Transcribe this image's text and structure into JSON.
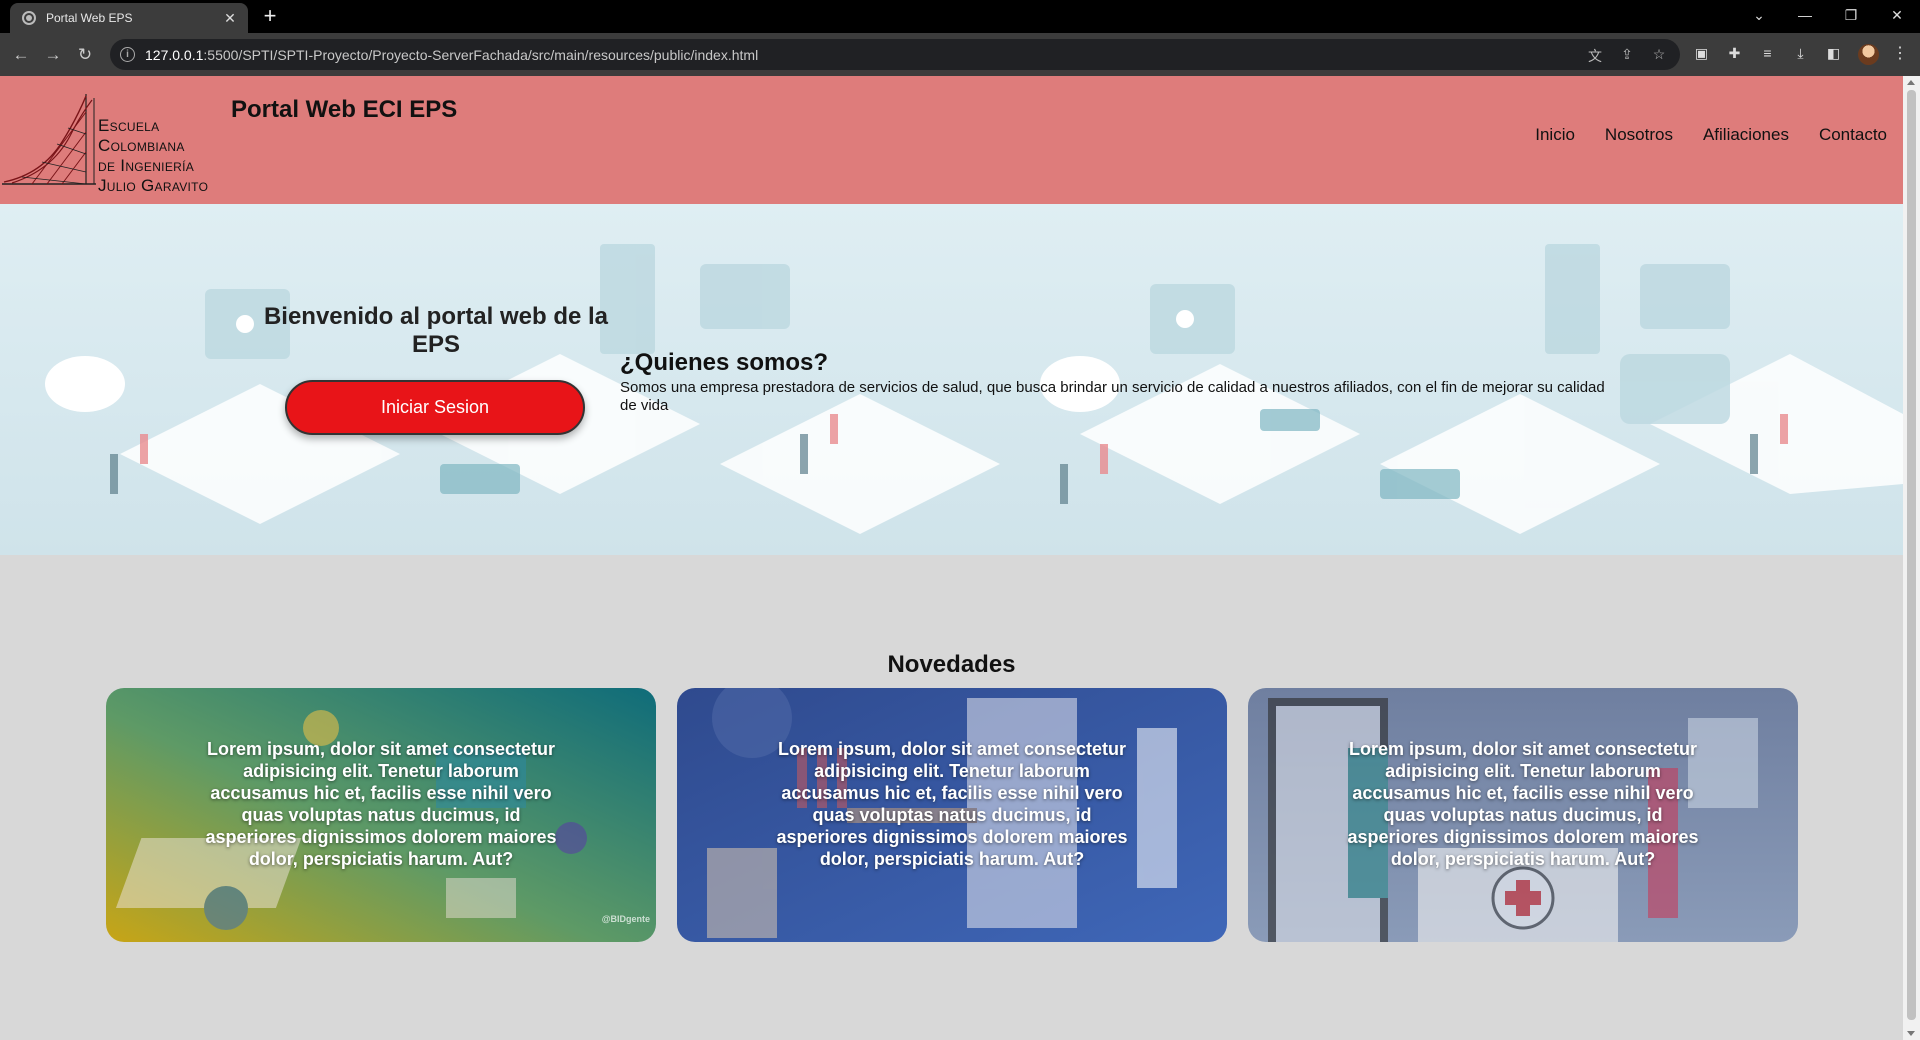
{
  "browser": {
    "tab_title": "Portal Web EPS",
    "tab_close": "✕",
    "new_tab": "+",
    "url_host": "127.0.0.1",
    "url_path": ":5500/SPTI/SPTI-Proyecto/Proyecto-ServerFachada/src/main/resources/public/index.html",
    "window_controls": [
      "⌄",
      "—",
      "❐",
      "✕"
    ],
    "nav": {
      "back": "←",
      "forward": "→",
      "reload": "↻"
    },
    "omnibox_icons": [
      "translate-icon",
      "share-icon",
      "star-icon"
    ],
    "extension_icons": [
      "cast-icon",
      "puzzle-icon",
      "playlist-icon",
      "download-icon",
      "sidebar-icon"
    ],
    "menu": "⋮"
  },
  "header": {
    "logo_lines": [
      "Escuela",
      "Colombiana",
      "de Ingeniería",
      "Julio Garavito"
    ],
    "site_title": "Portal Web ECI EPS",
    "nav": [
      "Inicio",
      "Nosotros",
      "Afiliaciones",
      "Contacto"
    ],
    "background_color": "#de7c7b"
  },
  "hero": {
    "welcome": "Bienvenido al portal web de la EPS",
    "login_button": "Iniciar Sesion",
    "login_button_color": "#e81418",
    "about_heading": "¿Quienes somos?",
    "about_text": "Somos una empresa prestadora de servicios de salud, que busca brindar un servicio de calidad a nuestros afiliados, con el fin de mejorar su calidad de vida"
  },
  "news": {
    "heading": "Novedades",
    "cards": [
      {
        "text": "Lorem ipsum, dolor sit amet consectetur adipisicing elit. Tenetur laborum accusamus hic et, facilis esse nihil vero quas voluptas natus ducimus, id asperiores dignissimos dolorem maiores dolor, perspiciatis harum. Aut?",
        "credit": "@BIDgente"
      },
      {
        "text": "Lorem ipsum, dolor sit amet consectetur adipisicing elit. Tenetur laborum accusamus hic et, facilis esse nihil vero quas voluptas natus ducimus, id asperiores dignissimos dolorem maiores dolor, perspiciatis harum. Aut?"
      },
      {
        "text": "Lorem ipsum, dolor sit amet consectetur adipisicing elit. Tenetur laborum accusamus hic et, facilis esse nihil vero quas voluptas natus ducimus, id asperiores dignissimos dolorem maiores dolor, perspiciatis harum. Aut?"
      }
    ]
  }
}
